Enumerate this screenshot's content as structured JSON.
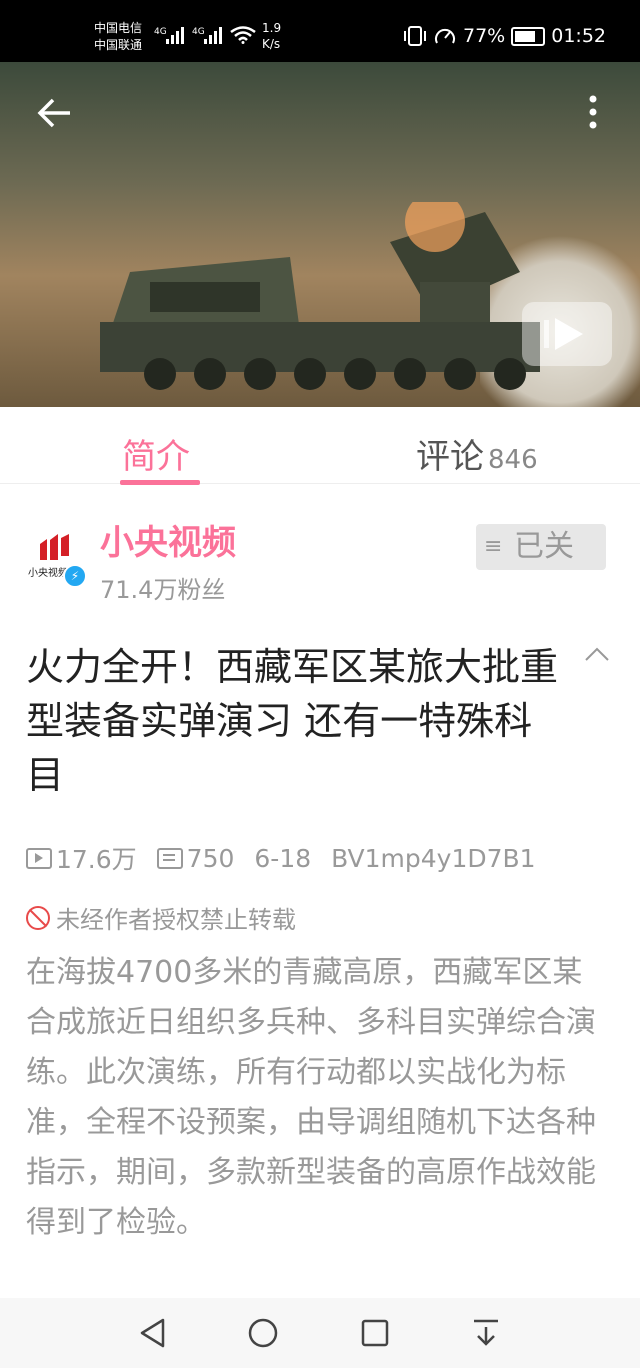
{
  "status_bar": {
    "carrier_1": "中国电信",
    "carrier_2": "中国联通",
    "net_1": "4G",
    "net_2": "4G",
    "speed_value": "1.9",
    "speed_unit": "K/s",
    "battery": "77%",
    "time": "01:52"
  },
  "video": {
    "back_icon": "arrow-left-icon",
    "more_icon": "more-vertical-icon",
    "play_icon": "play-icon"
  },
  "tabs": {
    "intro": "简介",
    "comments": "评论",
    "comments_count": "846"
  },
  "uploader": {
    "logo_text": "小央视频",
    "name": "小央视频",
    "fans": "71.4万粉丝",
    "follow_label": "已关"
  },
  "video_info": {
    "title": "火力全开！西藏军区某旅大批重型装备实弹演习 还有一特殊科目",
    "views": "17.6万",
    "danmaku": "750",
    "date": "6-18",
    "bvid": "BV1mp4y1D7B1",
    "notice": "未经作者授权禁止转载",
    "description": "在海拔4700多米的青藏高原，西藏军区某合成旅近日组织多兵种、多科目实弹综合演练。此次演练，所有行动都以实战化为标准，全程不设预案，由导调组随机下达各种指示，期间，多款新型装备的高原作战效能得到了检验。"
  },
  "colors": {
    "accent": "#fb7299",
    "text_gray": "#999999",
    "follow_bg": "#e7e7e7"
  }
}
